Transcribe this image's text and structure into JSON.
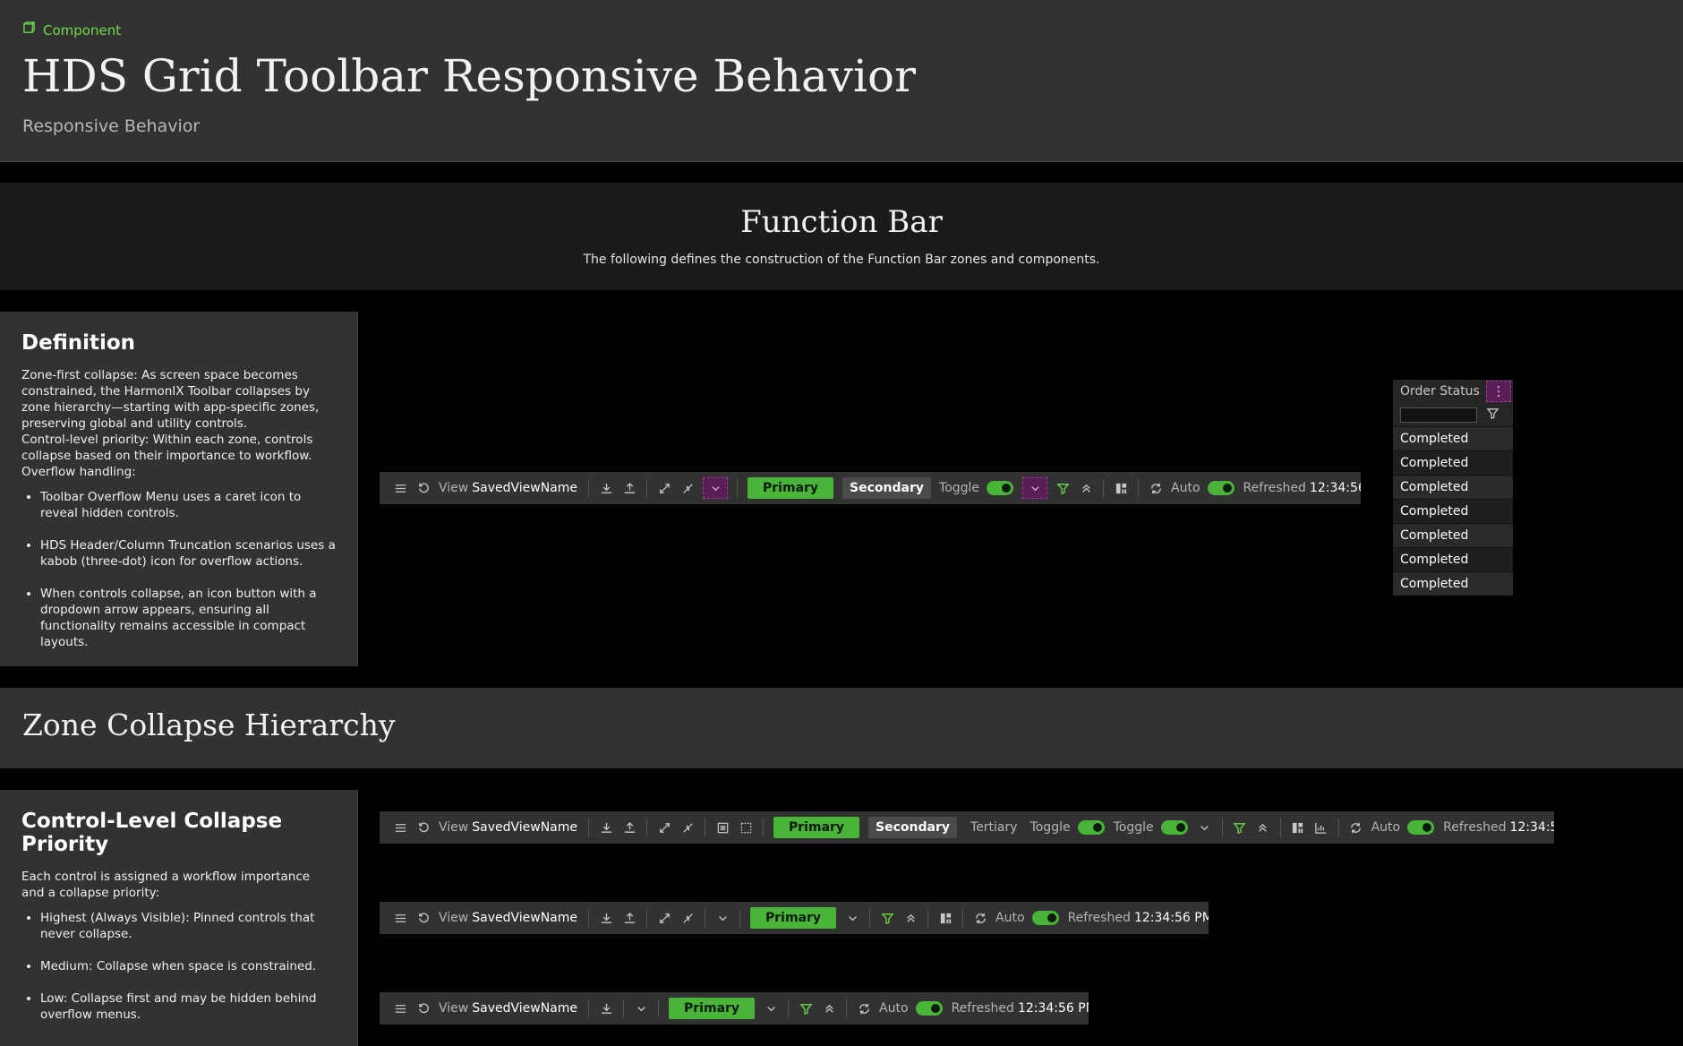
{
  "header": {
    "badge": "Component",
    "title": "HDS Grid Toolbar Responsive Behavior",
    "subtitle": "Responsive Behavior"
  },
  "function_bar": {
    "title": "Function Bar",
    "description": "The following defines the construction of the Function Bar zones and components."
  },
  "definition": {
    "title": "Definition",
    "body": "Zone-first collapse: As screen space becomes constrained, the HarmonIX Toolbar collapses by zone hierarchy—starting with app-specific zones, preserving global and utility controls.\nControl-level priority: Within each zone, controls collapse based on their importance to workflow.\nOverflow handling:",
    "bullets": [
      "Toolbar Overflow Menu uses a caret icon to reveal hidden controls.",
      "HDS Header/Column Truncation scenarios uses a kabob (three-dot) icon for overflow actions.",
      "When controls collapse, an icon button with a dropdown arrow appears, ensuring all functionality remains accessible in compact layouts."
    ]
  },
  "zone_collapse": {
    "title": "Zone Collapse Hierarchy"
  },
  "priority": {
    "title": "Control-Level Collapse Priority",
    "body": "Each control is assigned a workflow importance and a collapse priority:",
    "bullets": [
      "Highest (Always Visible): Pinned controls that never collapse.",
      "Medium: Collapse when space is constrained.",
      "Low: Collapse first and may be hidden behind overflow menus."
    ]
  },
  "toolbar": {
    "view_label": "View",
    "view_name": "SavedViewName",
    "primary": "Primary",
    "secondary": "Secondary",
    "tertiary": "Tertiary",
    "toggle": "Toggle",
    "auto": "Auto",
    "refreshed_label": "Refreshed",
    "refreshed_time": "12:34:56 PM"
  },
  "column_popup": {
    "header": "Order Status",
    "rows": [
      "Completed",
      "Completed",
      "Completed",
      "Completed",
      "Completed",
      "Completed",
      "Completed"
    ]
  },
  "colors": {
    "accent": "#4ab33a",
    "overflow": "#5a1e57",
    "panel": "#323232"
  }
}
